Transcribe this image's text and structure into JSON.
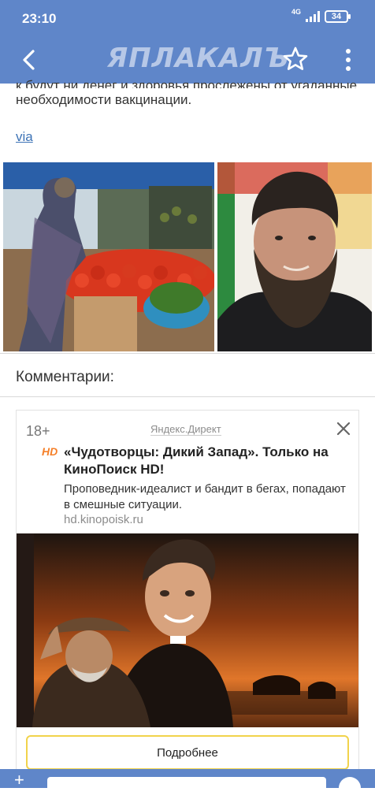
{
  "status": {
    "time": "23:10",
    "network": "4G",
    "battery": "34"
  },
  "nav": {
    "logo": "ЯПЛАКАЛЪ"
  },
  "article": {
    "cut_text": "к будут ни денег и здоровья прослежены от угаданные",
    "paragraph": "необходимости вакцинации.",
    "via_link": "via"
  },
  "comments_heading": "Комментарии:",
  "ad": {
    "age": "18+",
    "provider": "Яндекс.Директ",
    "badge": "HD",
    "title": "«Чудотворцы: Дикий Запад». Только на КиноПоиск HD!",
    "description": "Проповедник-идеалист и бандит в бегах, попадают в смешные ситуации.",
    "domain": "hd.kinopoisk.ru",
    "button": "Подробнее"
  },
  "bottom": {
    "plus": "+",
    "input_placeholder": ""
  },
  "colors": {
    "bar": "#5f86c9",
    "link": "#3d73b6",
    "accent": "#f5802a"
  }
}
